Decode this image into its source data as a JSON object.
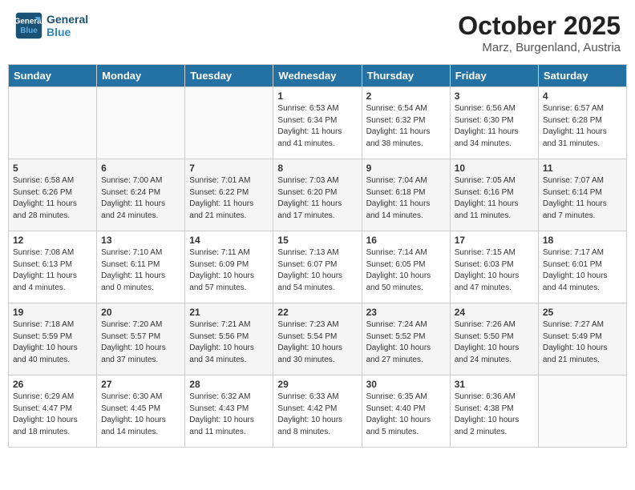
{
  "header": {
    "logo_line1": "General",
    "logo_line2": "Blue",
    "month": "October 2025",
    "location": "Marz, Burgenland, Austria"
  },
  "days_of_week": [
    "Sunday",
    "Monday",
    "Tuesday",
    "Wednesday",
    "Thursday",
    "Friday",
    "Saturday"
  ],
  "weeks": [
    [
      {
        "day": "",
        "info": ""
      },
      {
        "day": "",
        "info": ""
      },
      {
        "day": "",
        "info": ""
      },
      {
        "day": "1",
        "info": "Sunrise: 6:53 AM\nSunset: 6:34 PM\nDaylight: 11 hours and 41 minutes."
      },
      {
        "day": "2",
        "info": "Sunrise: 6:54 AM\nSunset: 6:32 PM\nDaylight: 11 hours and 38 minutes."
      },
      {
        "day": "3",
        "info": "Sunrise: 6:56 AM\nSunset: 6:30 PM\nDaylight: 11 hours and 34 minutes."
      },
      {
        "day": "4",
        "info": "Sunrise: 6:57 AM\nSunset: 6:28 PM\nDaylight: 11 hours and 31 minutes."
      }
    ],
    [
      {
        "day": "5",
        "info": "Sunrise: 6:58 AM\nSunset: 6:26 PM\nDaylight: 11 hours and 28 minutes."
      },
      {
        "day": "6",
        "info": "Sunrise: 7:00 AM\nSunset: 6:24 PM\nDaylight: 11 hours and 24 minutes."
      },
      {
        "day": "7",
        "info": "Sunrise: 7:01 AM\nSunset: 6:22 PM\nDaylight: 11 hours and 21 minutes."
      },
      {
        "day": "8",
        "info": "Sunrise: 7:03 AM\nSunset: 6:20 PM\nDaylight: 11 hours and 17 minutes."
      },
      {
        "day": "9",
        "info": "Sunrise: 7:04 AM\nSunset: 6:18 PM\nDaylight: 11 hours and 14 minutes."
      },
      {
        "day": "10",
        "info": "Sunrise: 7:05 AM\nSunset: 6:16 PM\nDaylight: 11 hours and 11 minutes."
      },
      {
        "day": "11",
        "info": "Sunrise: 7:07 AM\nSunset: 6:14 PM\nDaylight: 11 hours and 7 minutes."
      }
    ],
    [
      {
        "day": "12",
        "info": "Sunrise: 7:08 AM\nSunset: 6:13 PM\nDaylight: 11 hours and 4 minutes."
      },
      {
        "day": "13",
        "info": "Sunrise: 7:10 AM\nSunset: 6:11 PM\nDaylight: 11 hours and 0 minutes."
      },
      {
        "day": "14",
        "info": "Sunrise: 7:11 AM\nSunset: 6:09 PM\nDaylight: 10 hours and 57 minutes."
      },
      {
        "day": "15",
        "info": "Sunrise: 7:13 AM\nSunset: 6:07 PM\nDaylight: 10 hours and 54 minutes."
      },
      {
        "day": "16",
        "info": "Sunrise: 7:14 AM\nSunset: 6:05 PM\nDaylight: 10 hours and 50 minutes."
      },
      {
        "day": "17",
        "info": "Sunrise: 7:15 AM\nSunset: 6:03 PM\nDaylight: 10 hours and 47 minutes."
      },
      {
        "day": "18",
        "info": "Sunrise: 7:17 AM\nSunset: 6:01 PM\nDaylight: 10 hours and 44 minutes."
      }
    ],
    [
      {
        "day": "19",
        "info": "Sunrise: 7:18 AM\nSunset: 5:59 PM\nDaylight: 10 hours and 40 minutes."
      },
      {
        "day": "20",
        "info": "Sunrise: 7:20 AM\nSunset: 5:57 PM\nDaylight: 10 hours and 37 minutes."
      },
      {
        "day": "21",
        "info": "Sunrise: 7:21 AM\nSunset: 5:56 PM\nDaylight: 10 hours and 34 minutes."
      },
      {
        "day": "22",
        "info": "Sunrise: 7:23 AM\nSunset: 5:54 PM\nDaylight: 10 hours and 30 minutes."
      },
      {
        "day": "23",
        "info": "Sunrise: 7:24 AM\nSunset: 5:52 PM\nDaylight: 10 hours and 27 minutes."
      },
      {
        "day": "24",
        "info": "Sunrise: 7:26 AM\nSunset: 5:50 PM\nDaylight: 10 hours and 24 minutes."
      },
      {
        "day": "25",
        "info": "Sunrise: 7:27 AM\nSunset: 5:49 PM\nDaylight: 10 hours and 21 minutes."
      }
    ],
    [
      {
        "day": "26",
        "info": "Sunrise: 6:29 AM\nSunset: 4:47 PM\nDaylight: 10 hours and 18 minutes."
      },
      {
        "day": "27",
        "info": "Sunrise: 6:30 AM\nSunset: 4:45 PM\nDaylight: 10 hours and 14 minutes."
      },
      {
        "day": "28",
        "info": "Sunrise: 6:32 AM\nSunset: 4:43 PM\nDaylight: 10 hours and 11 minutes."
      },
      {
        "day": "29",
        "info": "Sunrise: 6:33 AM\nSunset: 4:42 PM\nDaylight: 10 hours and 8 minutes."
      },
      {
        "day": "30",
        "info": "Sunrise: 6:35 AM\nSunset: 4:40 PM\nDaylight: 10 hours and 5 minutes."
      },
      {
        "day": "31",
        "info": "Sunrise: 6:36 AM\nSunset: 4:38 PM\nDaylight: 10 hours and 2 minutes."
      },
      {
        "day": "",
        "info": ""
      }
    ]
  ]
}
